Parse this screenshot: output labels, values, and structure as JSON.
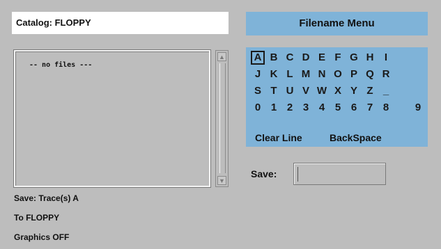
{
  "catalog": {
    "title": "Catalog: FLOPPY"
  },
  "menu": {
    "title": "Filename Menu"
  },
  "file_list": {
    "empty_text": "-- no files ---"
  },
  "keyboard": {
    "rows": [
      [
        "A",
        "B",
        "C",
        "D",
        "E",
        "F",
        "G",
        "H",
        "I"
      ],
      [
        "J",
        "K",
        "L",
        "M",
        "N",
        "O",
        "P",
        "Q",
        "R"
      ],
      [
        "S",
        "T",
        "U",
        "V",
        "W",
        "X",
        "Y",
        "Z",
        "_"
      ],
      [
        "0",
        "1",
        "2",
        "3",
        "4",
        "5",
        "6",
        "7",
        "8",
        "9"
      ]
    ],
    "selected": "A",
    "clear_line": "Clear Line",
    "backspace": "BackSpace"
  },
  "save": {
    "label": "Save:",
    "value": ""
  },
  "status": {
    "save_trace": "Save: Trace(s) A",
    "destination": "To FLOPPY",
    "graphics": "Graphics OFF"
  },
  "colors": {
    "background": "#bdbdbd",
    "menu_accent": "#7fb3d8"
  }
}
